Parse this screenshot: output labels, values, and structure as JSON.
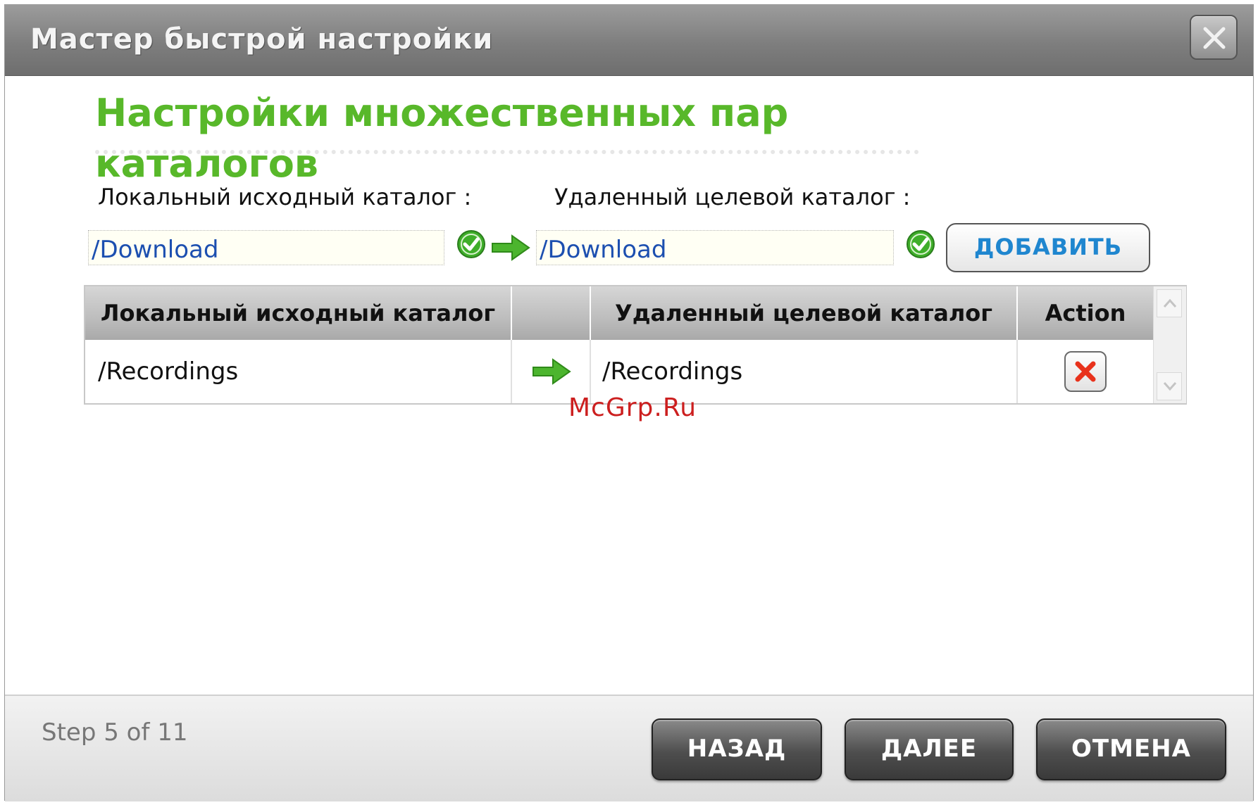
{
  "window": {
    "title": "Мастер быстрой настройки",
    "close_label": "X"
  },
  "heading": {
    "line1": "Настройки множественных пар",
    "line2": "каталогов"
  },
  "form": {
    "local_label": "Локальный исходный каталог :",
    "remote_label": "Удаленный целевой каталог :",
    "local_value": "/Download",
    "remote_value": "/Download",
    "add_button": "ДОБАВИТЬ"
  },
  "table": {
    "columns": [
      "Локальный исходный каталог",
      "",
      "Удаленный целевой каталог",
      "Action"
    ],
    "rows": [
      {
        "local": "/Recordings",
        "remote": "/Recordings"
      }
    ]
  },
  "watermark": "McGrp.Ru",
  "footer": {
    "step": "Step 5 of 11",
    "back_button": "НАЗАД",
    "next_button": "ДАЛЕЕ",
    "cancel_button": "ОТМЕНА"
  },
  "colors": {
    "heading_green": "#58b82a",
    "link_blue": "#1f86cf",
    "input_text_blue": "#1c4fb0",
    "delete_red": "#e8321c"
  },
  "icons": [
    "close-icon",
    "check-icon",
    "arrow-right-icon",
    "delete-icon",
    "scroll-up-icon",
    "scroll-down-icon"
  ]
}
